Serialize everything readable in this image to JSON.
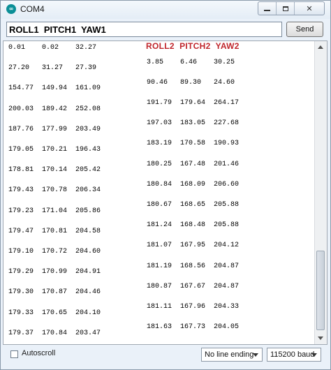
{
  "window": {
    "title": "COM4",
    "app_icon_glyph": "∞"
  },
  "send_bar": {
    "input_value": "ROLL1  PITCH1  YAW1",
    "send_label": "Send"
  },
  "output": {
    "header2": "ROLL2  PITCH2  YAW2",
    "lines": [
      {
        "indent": false,
        "text": "0.01    0.02    32.27"
      },
      {
        "indent": true,
        "text": "3.85    6.46    30.25"
      },
      {
        "indent": false,
        "text": "27.20   31.27   27.39"
      },
      {
        "indent": true,
        "text": "90.46   89.30   24.60"
      },
      {
        "indent": false,
        "text": "154.77  149.94  161.09"
      },
      {
        "indent": true,
        "text": "191.79  179.64  264.17"
      },
      {
        "indent": false,
        "text": "200.03  189.42  252.08"
      },
      {
        "indent": true,
        "text": "197.03  183.05  227.68"
      },
      {
        "indent": false,
        "text": "187.76  177.99  203.49"
      },
      {
        "indent": true,
        "text": "183.19  170.58  190.93"
      },
      {
        "indent": false,
        "text": "179.05  170.21  196.43"
      },
      {
        "indent": true,
        "text": "180.25  167.48  201.46"
      },
      {
        "indent": false,
        "text": "178.81  170.14  205.42"
      },
      {
        "indent": true,
        "text": "180.84  168.09  206.60"
      },
      {
        "indent": false,
        "text": "179.43  170.78  206.34"
      },
      {
        "indent": true,
        "text": "180.67  168.65  205.88"
      },
      {
        "indent": false,
        "text": "179.23  171.04  205.86"
      },
      {
        "indent": true,
        "text": "181.24  168.48  205.88"
      },
      {
        "indent": false,
        "text": "179.47  170.81  204.58"
      },
      {
        "indent": true,
        "text": "181.07  167.95  204.12"
      },
      {
        "indent": false,
        "text": "179.10  170.72  204.60"
      },
      {
        "indent": true,
        "text": "181.19  168.56  204.87"
      },
      {
        "indent": false,
        "text": "179.29  170.99  204.91"
      },
      {
        "indent": true,
        "text": "180.87  167.67  204.87"
      },
      {
        "indent": false,
        "text": "179.30  170.87  204.46"
      },
      {
        "indent": true,
        "text": "181.11  167.96  204.33"
      },
      {
        "indent": false,
        "text": "179.33  170.65  204.10"
      },
      {
        "indent": true,
        "text": "181.63  167.73  204.05"
      },
      {
        "indent": false,
        "text": "179.37  170.84  203.47"
      }
    ]
  },
  "bottom_bar": {
    "autoscroll_label": "Autoscroll",
    "autoscroll_checked": false,
    "line_ending_value": "No line ending",
    "baud_value": "115200 baud"
  },
  "colors": {
    "header2_color": "#c0262c",
    "app_icon_color": "#0b8f97"
  }
}
